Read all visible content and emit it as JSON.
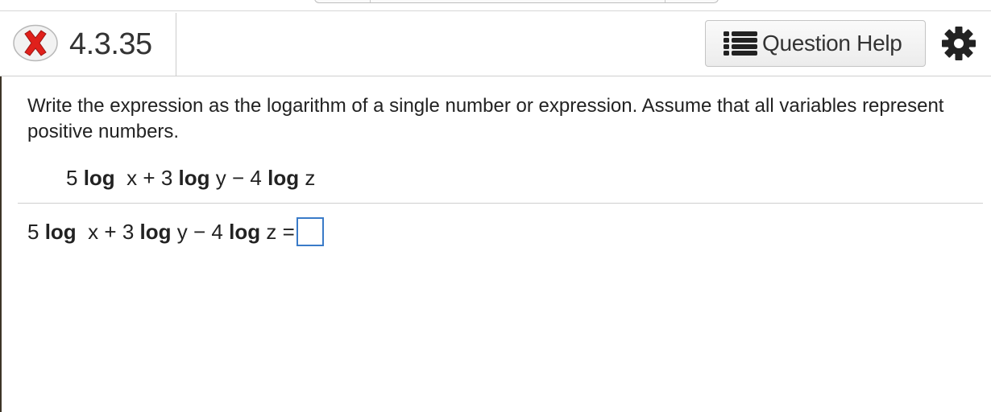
{
  "header": {
    "question_number": "4.3.35",
    "help_label": "Question Help"
  },
  "icons": {
    "status": "incorrect-x-icon",
    "help": "list-icon",
    "settings": "gear-icon"
  },
  "colors": {
    "status_red": "#e0201b",
    "answer_box_border": "#3a7bc8"
  },
  "question": {
    "instructions": "Write the expression as the logarithm of a single number or expression. Assume that all variables represent positive numbers.",
    "given": {
      "c1": "5",
      "log1": "log",
      "v1": "x",
      "op1": "+",
      "c2": "3",
      "log2": "log",
      "v2": "y",
      "op2": "−",
      "c3": "4",
      "log3": "log",
      "v3": "z"
    },
    "answer_prompt": {
      "c1": "5",
      "log1": "log",
      "v1": "x",
      "op1": "+",
      "c2": "3",
      "log2": "log",
      "v2": "y",
      "op2": "−",
      "c3": "4",
      "log3": "log",
      "v3": "z",
      "equals": "=",
      "answer_value": ""
    }
  }
}
